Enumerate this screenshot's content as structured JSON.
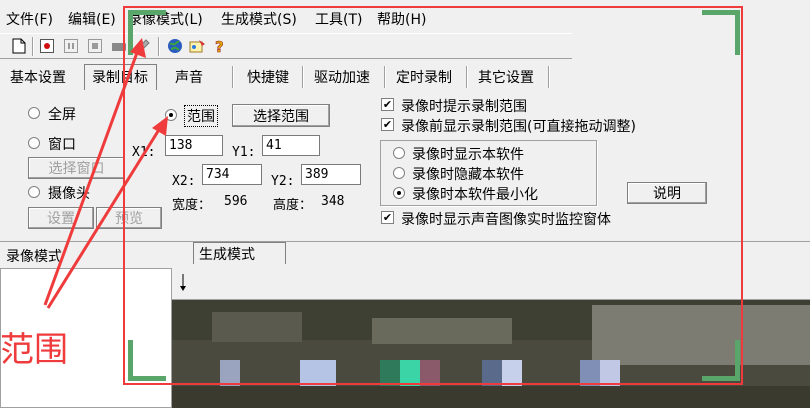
{
  "menu": [
    "文件(F)",
    "编辑(E)",
    "录像模式(L)",
    "生成模式(S)",
    "工具(T)",
    "帮助(H)"
  ],
  "toolbar_icons": [
    "new-icon",
    "record-icon",
    "pause-icon",
    "stop-icon",
    "camera-icon",
    "pen-icon",
    "globe-icon",
    "paint-icon",
    "help-icon"
  ],
  "tabs": [
    "基本设置",
    "录制目标",
    "声音",
    "快捷键",
    "驱动加速",
    "定时录制",
    "其它设置"
  ],
  "active_tab_index": 1,
  "targets": {
    "fullscreen": "全屏",
    "window": "窗口",
    "select_window": "选择窗口",
    "camera": "摄像头",
    "settings": "设置",
    "preview": "预览",
    "region": "范围",
    "select_region": "选择范围",
    "selected": "region"
  },
  "coords": {
    "x1_label": "X1:",
    "x1": "138",
    "y1_label": "Y1:",
    "y1": "41",
    "x2_label": "X2:",
    "x2": "734",
    "y2_label": "Y2:",
    "y2": "389",
    "width_label": "宽度：",
    "width": "596",
    "height_label": "高度：",
    "height": "348"
  },
  "options": {
    "show_region_hint": "录像时提示录制范围",
    "show_region_before": "录像前显示录制范围(可直接拖动调整)",
    "show_app": "录像时显示本软件",
    "hide_app": "录像时隐藏本软件",
    "minimize_app": "录像时本软件最小化",
    "selected_app_mode": "minimize",
    "explain": "说明",
    "show_monitor": "录像时显示声音图像实时监控窗体"
  },
  "lower": {
    "record_mode": "录像模式",
    "gen_mode": "生成模式"
  },
  "annotation": {
    "label": "范围",
    "color": "#ef3b3b",
    "corner_color": "#5aa56a"
  }
}
